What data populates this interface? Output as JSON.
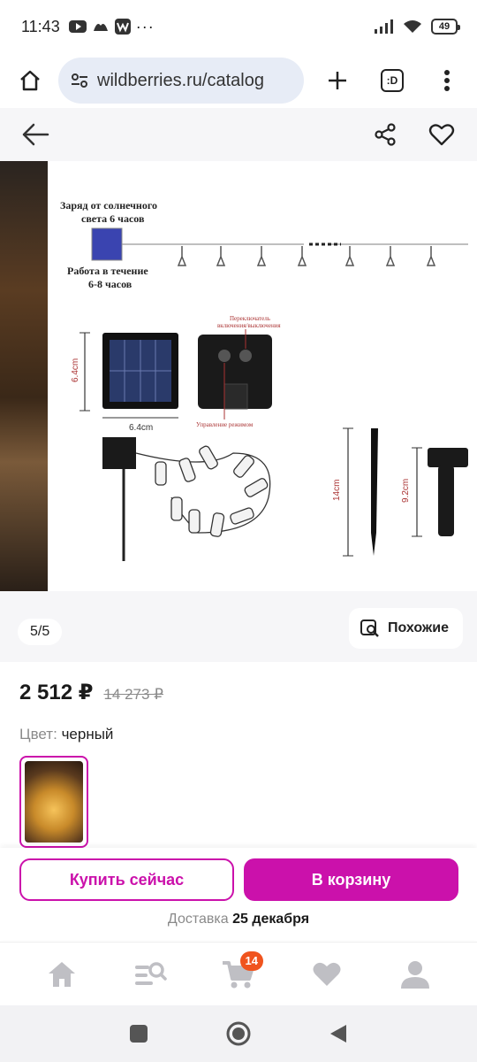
{
  "status_bar": {
    "time": "11:43",
    "battery": "49"
  },
  "browser": {
    "url": "wildberries.ru/catalog",
    "tab_count": ":D"
  },
  "product_image": {
    "solar_label_1": "Заряд от солнечного",
    "solar_label_2": "света 6 часов",
    "work_label_1": "Работа в течение",
    "work_label_2": "6-8 часов",
    "switch_label_1": "Переключатель",
    "switch_label_2": "включения/выключения",
    "mode_label": "Управление режимом",
    "dim_height": "6.4cm",
    "dim_width": "6.4cm",
    "dim_stake": "14cm",
    "dim_holder": "9.2cm"
  },
  "gallery": {
    "counter": "5/5",
    "similar_label": "Похожие"
  },
  "product": {
    "price_current": "2 512 ₽",
    "price_old": "14 273 ₽",
    "color_label": "Цвет:",
    "color_value": "черный"
  },
  "actions": {
    "buy_now": "Купить сейчас",
    "add_to_cart": "В корзину",
    "delivery_label": "Доставка",
    "delivery_date": "25 декабря"
  },
  "bottom_nav": {
    "cart_badge": "14"
  },
  "colors": {
    "accent": "#cb11ab",
    "badge": "#f0541e",
    "nav_icon": "#bfbfc4"
  }
}
